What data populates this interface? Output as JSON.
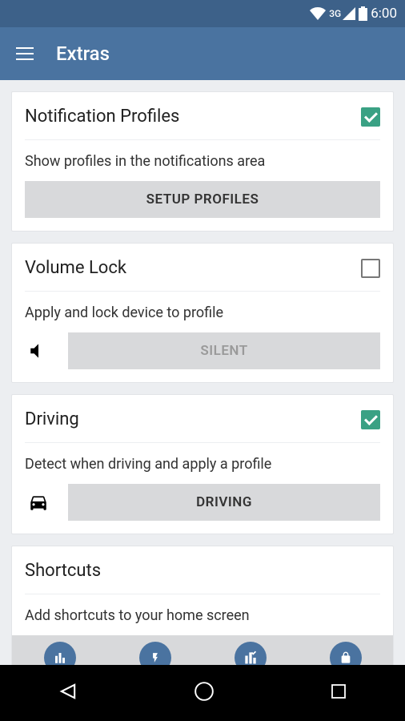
{
  "status": {
    "network": "3G",
    "time": "6:00"
  },
  "header": {
    "title": "Extras"
  },
  "cards": {
    "notification": {
      "title": "Notification Profiles",
      "checked": true,
      "desc": "Show profiles in the notifications area",
      "button": "SETUP PROFILES"
    },
    "volume": {
      "title": "Volume Lock",
      "checked": false,
      "desc": "Apply and lock device to profile",
      "button": "SILENT"
    },
    "driving": {
      "title": "Driving",
      "checked": true,
      "desc": "Detect when driving and apply a profile",
      "button": "DRIVING"
    },
    "shortcuts": {
      "title": "Shortcuts",
      "desc": "Add shortcuts to your home screen"
    }
  }
}
